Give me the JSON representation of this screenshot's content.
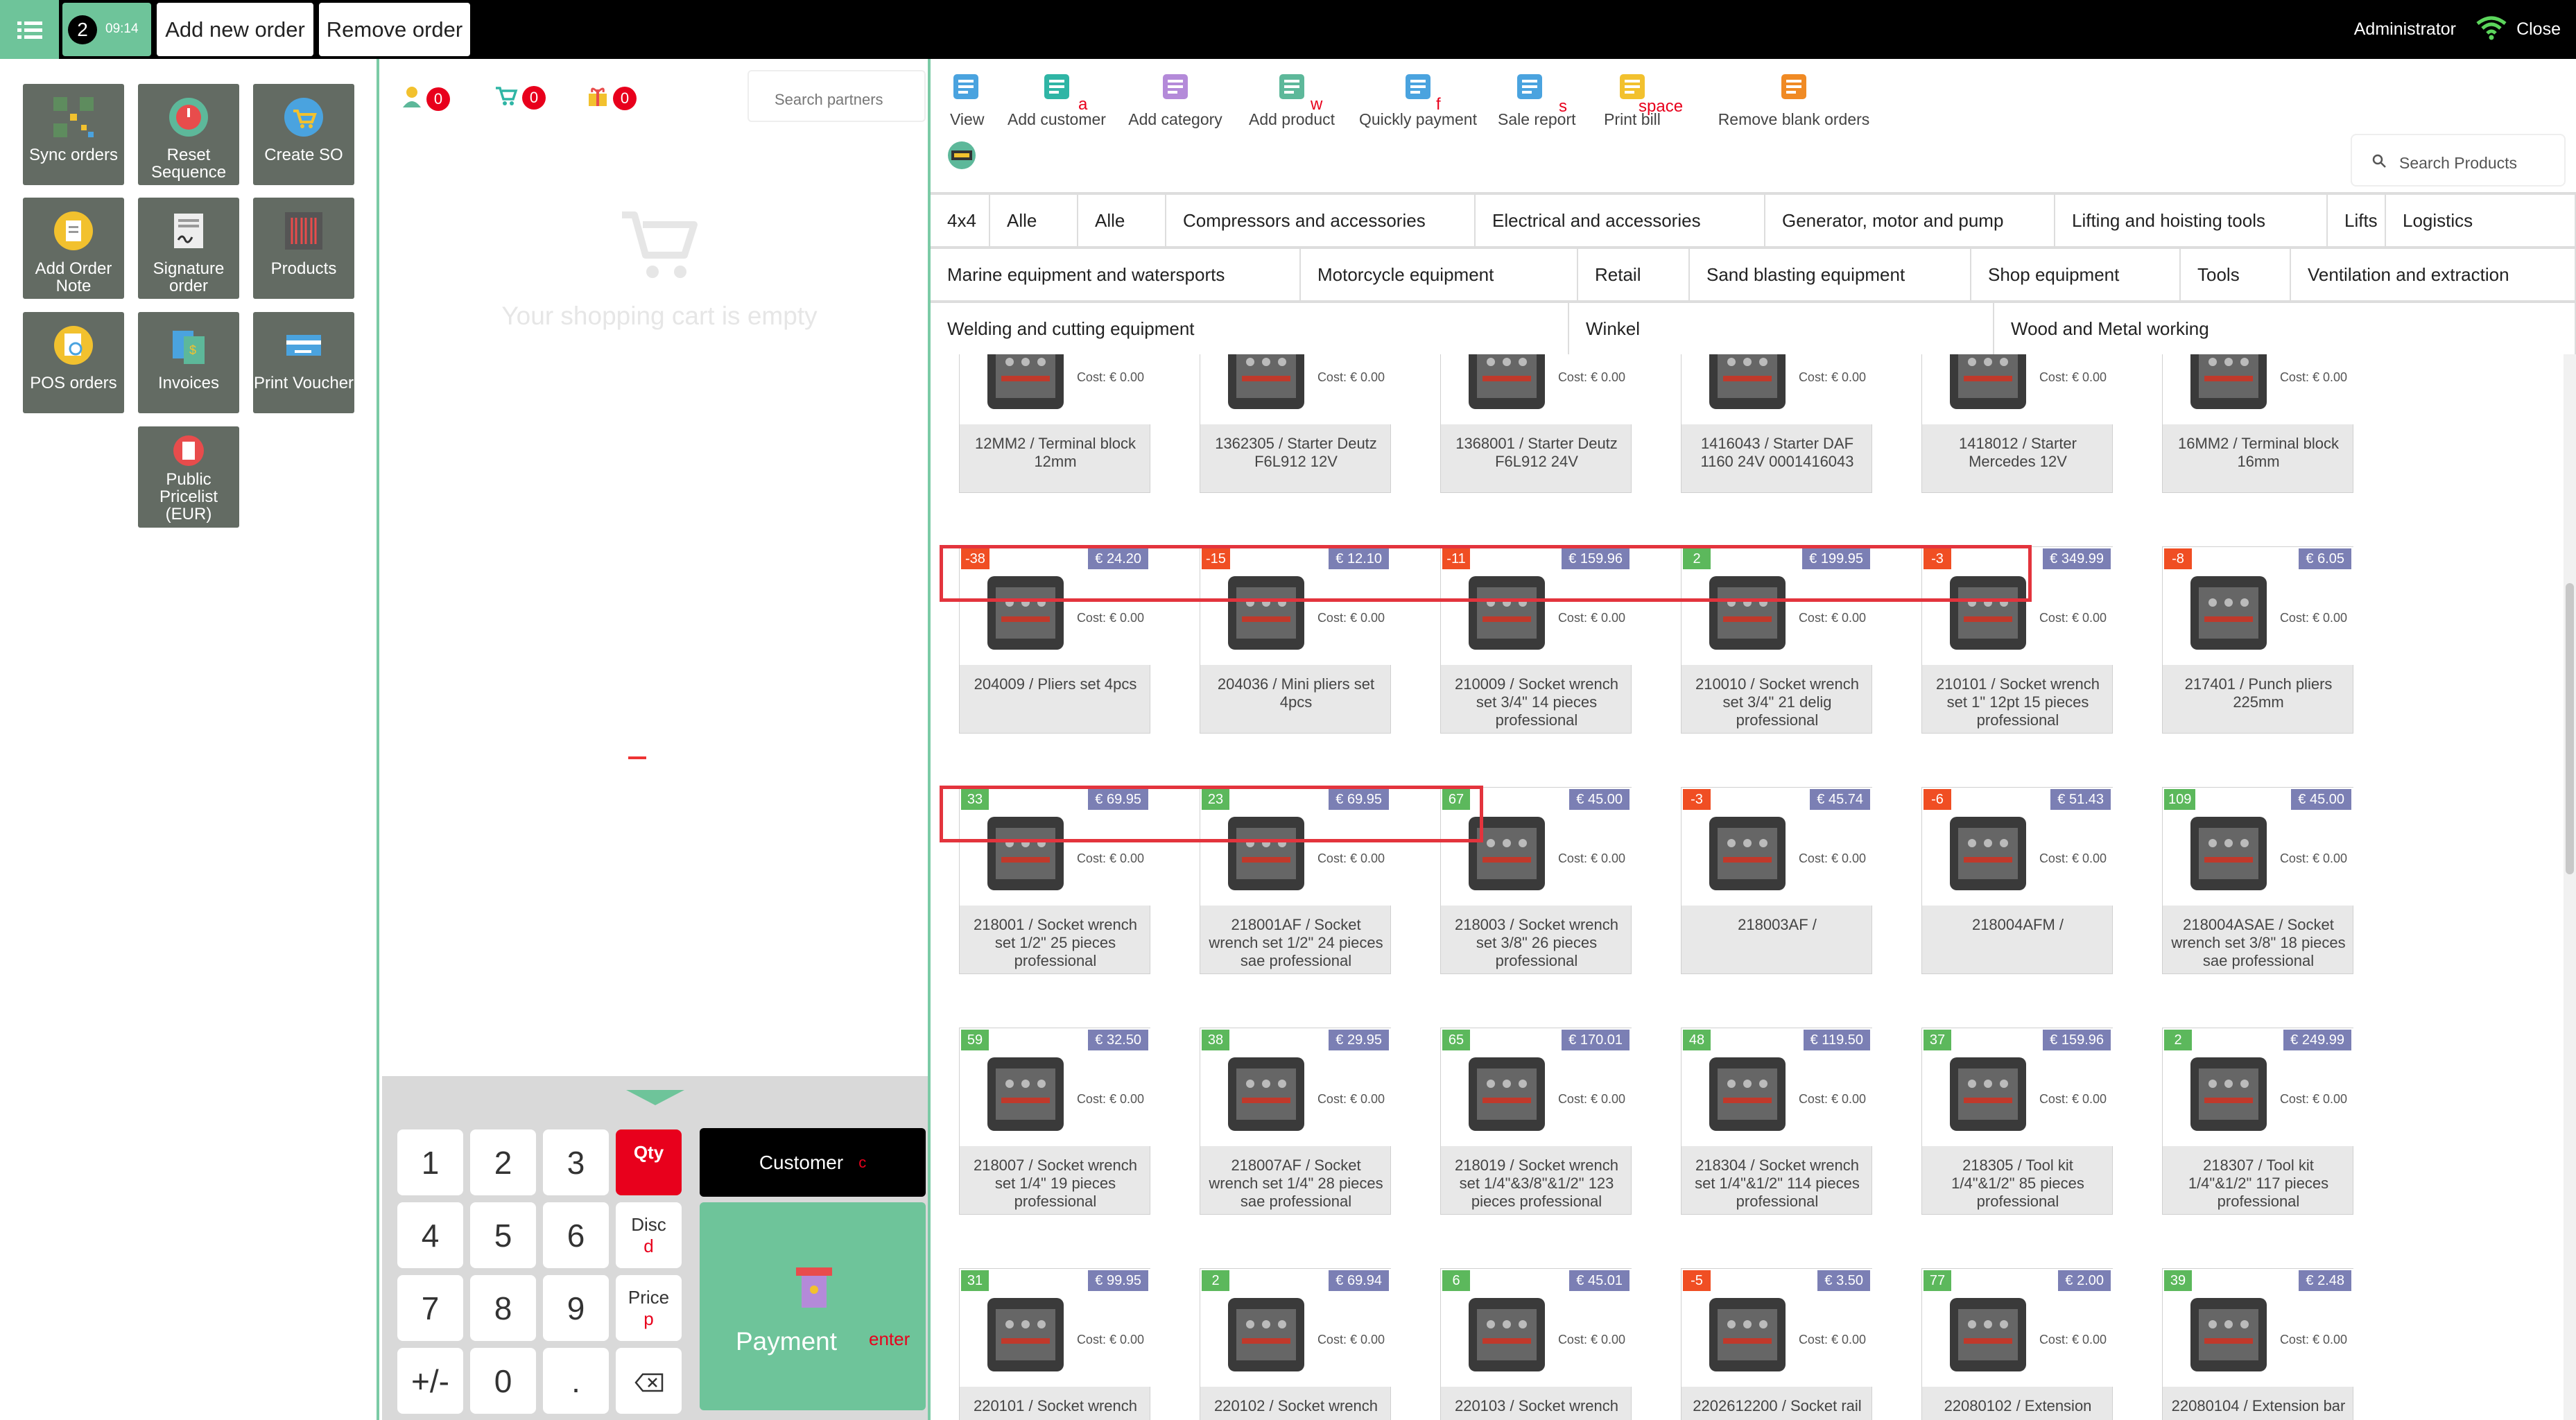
{
  "topbar": {
    "order_number": "2",
    "order_time": "09:14",
    "add_order_label": "Add new order",
    "remove_order_label": "Remove order",
    "user": "Administrator",
    "close_label": "Close"
  },
  "sidebar": {
    "tiles": [
      "Sync orders",
      "Reset Sequence",
      "Create SO",
      "Add Order Note",
      "Signature order",
      "Products",
      "POS orders",
      "Invoices",
      "Print Voucher",
      "Public Pricelist (EUR)"
    ]
  },
  "cart": {
    "count1": "0",
    "count2": "0",
    "count3": "0",
    "partner_placeholder": "Search partners",
    "empty_text": "Your shopping cart is empty"
  },
  "numpad": {
    "keys": [
      "1",
      "2",
      "3",
      "4",
      "5",
      "6",
      "7",
      "8",
      "9",
      "+/-",
      "0",
      "."
    ],
    "qty_label": "Qty",
    "disc_label": "Disc",
    "disc_hint": "d",
    "price_label": "Price",
    "price_hint": "p",
    "customer_label": "Customer",
    "customer_hint": "c",
    "payment_label": "Payment",
    "payment_hint": "enter"
  },
  "actions": [
    {
      "label": "View",
      "hint": ""
    },
    {
      "label": "Add customer",
      "hint": "a"
    },
    {
      "label": "Add category",
      "hint": ""
    },
    {
      "label": "Add product",
      "hint": "w"
    },
    {
      "label": "Quickly payment",
      "hint": "f"
    },
    {
      "label": "Sale report",
      "hint": "s"
    },
    {
      "label": "Print bill",
      "hint": "space"
    },
    {
      "label": "Remove blank orders",
      "hint": ""
    }
  ],
  "product_search_placeholder": "Search Products",
  "categories": [
    "4x4",
    "Alle",
    "Alle",
    "Compressors and accessories",
    "Electrical and accessories",
    "Generator, motor and pump",
    "Lifting and hoisting tools",
    "Lifts",
    "Logistics",
    "Marine equipment and watersports",
    "Motorcycle equipment",
    "Retail",
    "Sand blasting equipment",
    "Shop equipment",
    "Tools",
    "Ventilation and extraction",
    "Welding and cutting equipment",
    "Winkel",
    "Wood and Metal working"
  ],
  "cost_label": "Cost: € 0.00",
  "products": [
    {
      "name": "12MM2 / Terminal block 12mm",
      "qty": "",
      "price": ""
    },
    {
      "name": "1362305 / Starter Deutz F6L912 12V",
      "qty": "",
      "price": ""
    },
    {
      "name": "1368001 / Starter Deutz F6L912 24V",
      "qty": "",
      "price": ""
    },
    {
      "name": "1416043 / Starter DAF 1160 24V 0001416043",
      "qty": "",
      "price": ""
    },
    {
      "name": "1418012 / Starter Mercedes 12V",
      "qty": "",
      "price": ""
    },
    {
      "name": "16MM2 / Terminal block 16mm",
      "qty": "",
      "price": ""
    },
    {
      "name": "204009 / Pliers set 4pcs",
      "qty": "-38",
      "price": "€ 24.20"
    },
    {
      "name": "204036 / Mini pliers set 4pcs",
      "qty": "-15",
      "price": "€ 12.10"
    },
    {
      "name": "210009 / Socket wrench set 3/4\" 14 pieces professional",
      "qty": "-11",
      "price": "€ 159.96"
    },
    {
      "name": "210010 / Socket wrench set 3/4\" 21 delig professional",
      "qty": "2",
      "price": "€ 199.95"
    },
    {
      "name": "210101 / Socket wrench set 1\" 12pt 15 pieces professional",
      "qty": "-3",
      "price": "€ 349.99"
    },
    {
      "name": "217401 / Punch pliers 225mm",
      "qty": "-8",
      "price": "€ 6.05"
    },
    {
      "name": "218001 / Socket wrench set 1/2\" 25 pieces professional",
      "qty": "33",
      "price": "€ 69.95"
    },
    {
      "name": "218001AF / Socket wrench set 1/2\" 24 pieces sae professional",
      "qty": "23",
      "price": "€ 69.95"
    },
    {
      "name": "218003 / Socket wrench set 3/8\" 26 pieces professional",
      "qty": "67",
      "price": "€ 45.00"
    },
    {
      "name": "218003AF /",
      "qty": "-3",
      "price": "€ 45.74"
    },
    {
      "name": "218004AFM /",
      "qty": "-6",
      "price": "€ 51.43"
    },
    {
      "name": "218004ASAE / Socket wrench set 3/8\" 18 pieces sae professional",
      "qty": "109",
      "price": "€ 45.00"
    },
    {
      "name": "218007 / Socket wrench set 1/4\" 19 pieces professional",
      "qty": "59",
      "price": "€ 32.50"
    },
    {
      "name": "218007AF / Socket wrench set 1/4\" 28 pieces sae professional",
      "qty": "38",
      "price": "€ 29.95"
    },
    {
      "name": "218019 / Socket wrench set 1/4\"&3/8\"&1/2\" 123 pieces professional",
      "qty": "65",
      "price": "€ 170.01"
    },
    {
      "name": "218304 / Socket wrench set 1/4\"&1/2\" 114 pieces professional",
      "qty": "48",
      "price": "€ 119.50"
    },
    {
      "name": "218305 / Tool kit 1/4\"&1/2\" 85 pieces professional",
      "qty": "37",
      "price": "€ 159.96"
    },
    {
      "name": "218307 / Tool kit 1/4\"&1/2\" 117 pieces professional",
      "qty": "2",
      "price": "€ 249.99"
    },
    {
      "name": "220101 / Socket wrench",
      "qty": "31",
      "price": "€ 99.95"
    },
    {
      "name": "220102 / Socket wrench",
      "qty": "2",
      "price": "€ 69.94"
    },
    {
      "name": "220103 / Socket wrench",
      "qty": "6",
      "price": "€ 45.01"
    },
    {
      "name": "2202612200 / Socket rail",
      "qty": "-5",
      "price": "€ 3.50"
    },
    {
      "name": "22080102 / Extension",
      "qty": "77",
      "price": "€ 2.00"
    },
    {
      "name": "22080104 / Extension bar",
      "qty": "39",
      "price": "€ 2.48"
    }
  ],
  "colors": {
    "accent": "#6ec49a",
    "danger": "#e8001c",
    "price_badge": "#7b7fb4",
    "qty_negative": "#f04e23",
    "qty_positive": "#5cb85c",
    "highlight": "#e3343d"
  }
}
